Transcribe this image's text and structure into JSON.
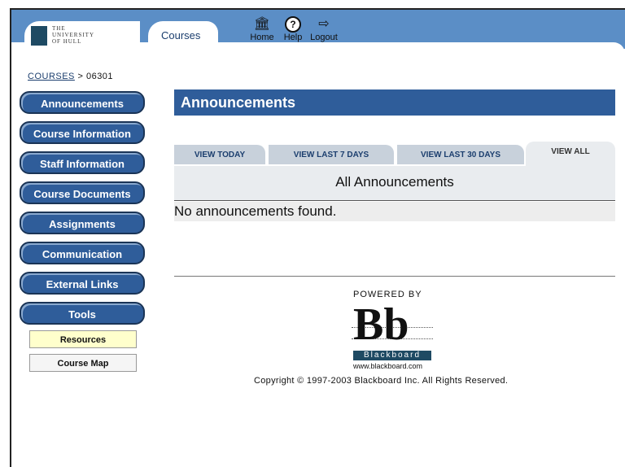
{
  "header": {
    "logo_lines": [
      "THE",
      "UNIVERSITY",
      "OF HULL"
    ],
    "courses_tab": "Courses",
    "home_label": "Home",
    "help_label": "Help",
    "logout_label": "Logout"
  },
  "breadcrumb": {
    "link": "COURSES",
    "separator": " > ",
    "current": "06301"
  },
  "sidebar": {
    "items": [
      {
        "label": "Announcements"
      },
      {
        "label": "Course Information"
      },
      {
        "label": "Staff Information"
      },
      {
        "label": "Course Documents"
      },
      {
        "label": "Assignments"
      },
      {
        "label": "Communication"
      },
      {
        "label": "External Links"
      },
      {
        "label": "Tools"
      }
    ],
    "sub_items": [
      {
        "label": "Resources",
        "color": "#ffffcc"
      },
      {
        "label": "Course Map",
        "color": "#f5f5f5"
      }
    ]
  },
  "main": {
    "title": "Announcements",
    "tabs": [
      {
        "label": "VIEW TODAY"
      },
      {
        "label": "VIEW LAST 7 DAYS"
      },
      {
        "label": "VIEW LAST 30 DAYS"
      },
      {
        "label": "VIEW ALL",
        "active": true
      }
    ],
    "section_title": "All Announcements",
    "empty_message": "No announcements found."
  },
  "footer": {
    "powered_by": "POWERED BY",
    "logo_text": "Bb",
    "brand": "Blackboard",
    "url": "www.blackboard.com",
    "copyright": "Copyright © 1997-2003 Blackboard Inc. All Rights Reserved."
  },
  "colors": {
    "header_bg": "#5b8ec6",
    "nav_blue": "#2f5d9a",
    "tab_inactive": "#c8d1db",
    "tab_active": "#e9ecef"
  }
}
